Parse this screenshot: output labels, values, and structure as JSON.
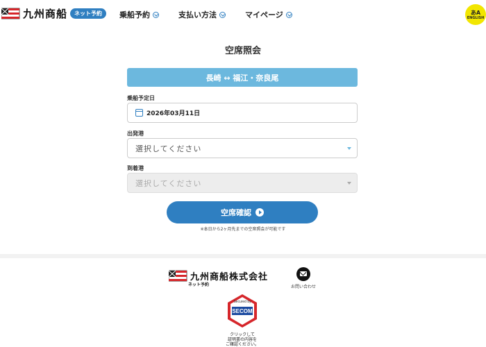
{
  "header": {
    "logo_text": "九州商船",
    "badge": "ネット予約",
    "nav": [
      {
        "label": "乗船予約"
      },
      {
        "label": "支払い方法"
      },
      {
        "label": "マイページ"
      }
    ],
    "english_glyph": "あA",
    "english_label": "ENGLISH"
  },
  "main": {
    "title": "空席照会",
    "route": "長崎 ↔ 福江・奈良尾",
    "date_label": "乗船予定日",
    "date_value": "2026年03月11日",
    "departure_label": "出発港",
    "departure_placeholder": "選択してください",
    "arrival_label": "到着港",
    "arrival_placeholder": "選択してください",
    "confirm_label": "空席確認",
    "note": "※本日から2ヶ月先までの空席照会が可能です"
  },
  "footer": {
    "company": "九州商船株式会社",
    "sub": "ネット予約",
    "contact_label": "お問い合わせ",
    "secom_top": "Secured by",
    "secom_brand": "SECOM",
    "secom_note_1": "クリックして",
    "secom_note_2": "証明書の内容を",
    "secom_note_3": "ご確認ください。"
  },
  "colors": {
    "accent": "#2f7fc1",
    "route_bar": "#6cb8de",
    "english_button": "#f2e600",
    "secom_red": "#d6262b"
  }
}
